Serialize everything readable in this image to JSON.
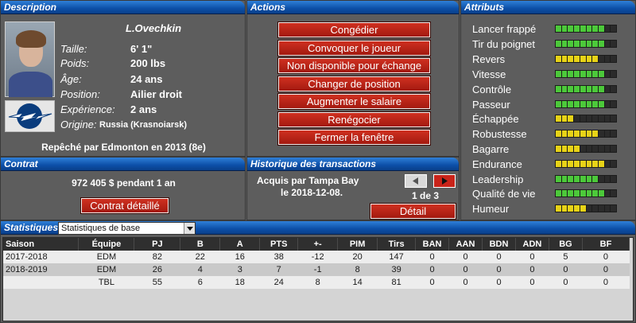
{
  "headers": {
    "description": "Description",
    "actions": "Actions",
    "attributes": "Attributs",
    "contract": "Contrat",
    "transactions": "Historique des transactions",
    "statistics": "Statistiques"
  },
  "player": {
    "name": "L.Ovechkin",
    "fields": [
      {
        "label": "Taille:",
        "value": "6' 1\""
      },
      {
        "label": "Poids:",
        "value": "200 lbs"
      },
      {
        "label": "Âge:",
        "value": "24 ans"
      },
      {
        "label": "Position:",
        "value": "Ailier droit"
      },
      {
        "label": "Expérience:",
        "value": "2 ans"
      },
      {
        "label": "Origine:",
        "value": "Russia (Krasnoiarsk)"
      }
    ],
    "draft": "Repêché par Edmonton en 2013 (8e)"
  },
  "actions": [
    "Congédier",
    "Convoquer le joueur",
    "Non disponible pour échange",
    "Changer de position",
    "Augmenter le salaire",
    "Renégocier",
    "Fermer la fenêtre"
  ],
  "attributes": [
    {
      "name": "Lancer frappé",
      "filled": 8,
      "color": "#4cc93a"
    },
    {
      "name": "Tir du poignet",
      "filled": 8,
      "color": "#4cc93a"
    },
    {
      "name": "Revers",
      "filled": 7,
      "color": "#e8d317"
    },
    {
      "name": "Vitesse",
      "filled": 8,
      "color": "#4cc93a"
    },
    {
      "name": "Contrôle",
      "filled": 8,
      "color": "#4cc93a"
    },
    {
      "name": "Passeur",
      "filled": 8,
      "color": "#4cc93a"
    },
    {
      "name": "Échappée",
      "filled": 3,
      "color": "#e8d317"
    },
    {
      "name": "Robustesse",
      "filled": 7,
      "color": "#e8d317"
    },
    {
      "name": "Bagarre",
      "filled": 4,
      "color": "#e8d317"
    },
    {
      "name": "Endurance",
      "filled": 8,
      "color": "#e8d317"
    },
    {
      "name": "Leadership",
      "filled": 7,
      "color": "#4cc93a"
    },
    {
      "name": "Qualité de vie",
      "filled": 8,
      "color": "#4cc93a"
    },
    {
      "name": "Humeur",
      "filled": 5,
      "color": "#e8d317"
    }
  ],
  "contract": {
    "text": "972 405 $ pendant 1 an",
    "button": "Contrat détaillé"
  },
  "transactions": {
    "line1": "Acquis par Tampa Bay",
    "line2": "le 2018-12-08.",
    "page": "1 de 3",
    "prev_icon": "arrow-left-icon",
    "next_icon": "arrow-right-icon",
    "detail_button": "Détail"
  },
  "stats": {
    "selected_view": "Statistiques de base",
    "columns": [
      "Saison",
      "Équipe",
      "PJ",
      "B",
      "A",
      "PTS",
      "+-",
      "PIM",
      "Tirs",
      "BAN",
      "AAN",
      "BDN",
      "ADN",
      "BG",
      "BF"
    ],
    "rows": [
      [
        "2017-2018",
        "EDM",
        "82",
        "22",
        "16",
        "38",
        "-12",
        "20",
        "147",
        "0",
        "0",
        "0",
        "0",
        "5",
        "0"
      ],
      [
        "2018-2019",
        "EDM",
        "26",
        "4",
        "3",
        "7",
        "-1",
        "8",
        "39",
        "0",
        "0",
        "0",
        "0",
        "0",
        "0"
      ],
      [
        "",
        "TBL",
        "55",
        "6",
        "18",
        "24",
        "8",
        "14",
        "81",
        "0",
        "0",
        "0",
        "0",
        "0",
        "0"
      ]
    ]
  },
  "colors": {
    "header_blue": "#0c4fa8",
    "button_red": "#b8241a",
    "bar_green": "#4cc93a",
    "bar_yellow": "#e8d317"
  }
}
